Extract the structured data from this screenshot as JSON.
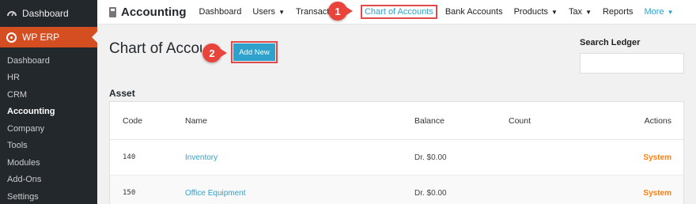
{
  "sidebar": {
    "dashboard_label": "Dashboard",
    "erp_label": "WP ERP",
    "items": [
      {
        "label": "Dashboard"
      },
      {
        "label": "HR"
      },
      {
        "label": "CRM"
      },
      {
        "label": "Accounting"
      },
      {
        "label": "Company"
      },
      {
        "label": "Tools"
      },
      {
        "label": "Modules"
      },
      {
        "label": "Add-Ons"
      },
      {
        "label": "Settings"
      }
    ],
    "active_item": "Accounting"
  },
  "topbar": {
    "brand_icon": "calculator-icon",
    "brand_title": "Accounting",
    "nav": {
      "dashboard": "Dashboard",
      "users": "Users",
      "transactions": "Transactions",
      "chart_of_accounts": "Chart of Accounts",
      "bank_accounts": "Bank Accounts",
      "products": "Products",
      "tax": "Tax",
      "reports": "Reports",
      "more": "More"
    }
  },
  "callouts": {
    "one": "1",
    "two": "2"
  },
  "page": {
    "title": "Chart of Accounts",
    "add_button": "Add New",
    "search_label": "Search Ledger",
    "search_value": "",
    "section_title": "Asset"
  },
  "table": {
    "headers": {
      "code": "Code",
      "name": "Name",
      "balance": "Balance",
      "count": "Count",
      "actions": "Actions"
    },
    "rows": [
      {
        "code": "140",
        "name": "Inventory",
        "balance": "Dr. $0.00",
        "count": "",
        "actions": "System"
      },
      {
        "code": "150",
        "name": "Office Equipment",
        "balance": "Dr. $0.00",
        "count": "",
        "actions": "System"
      }
    ]
  },
  "colors": {
    "sidebar_bg": "#23282d",
    "erp_highlight": "#d54e21",
    "link": "#2ea2cc",
    "system_action": "#ff7f0e",
    "callout": "#e8443c"
  }
}
